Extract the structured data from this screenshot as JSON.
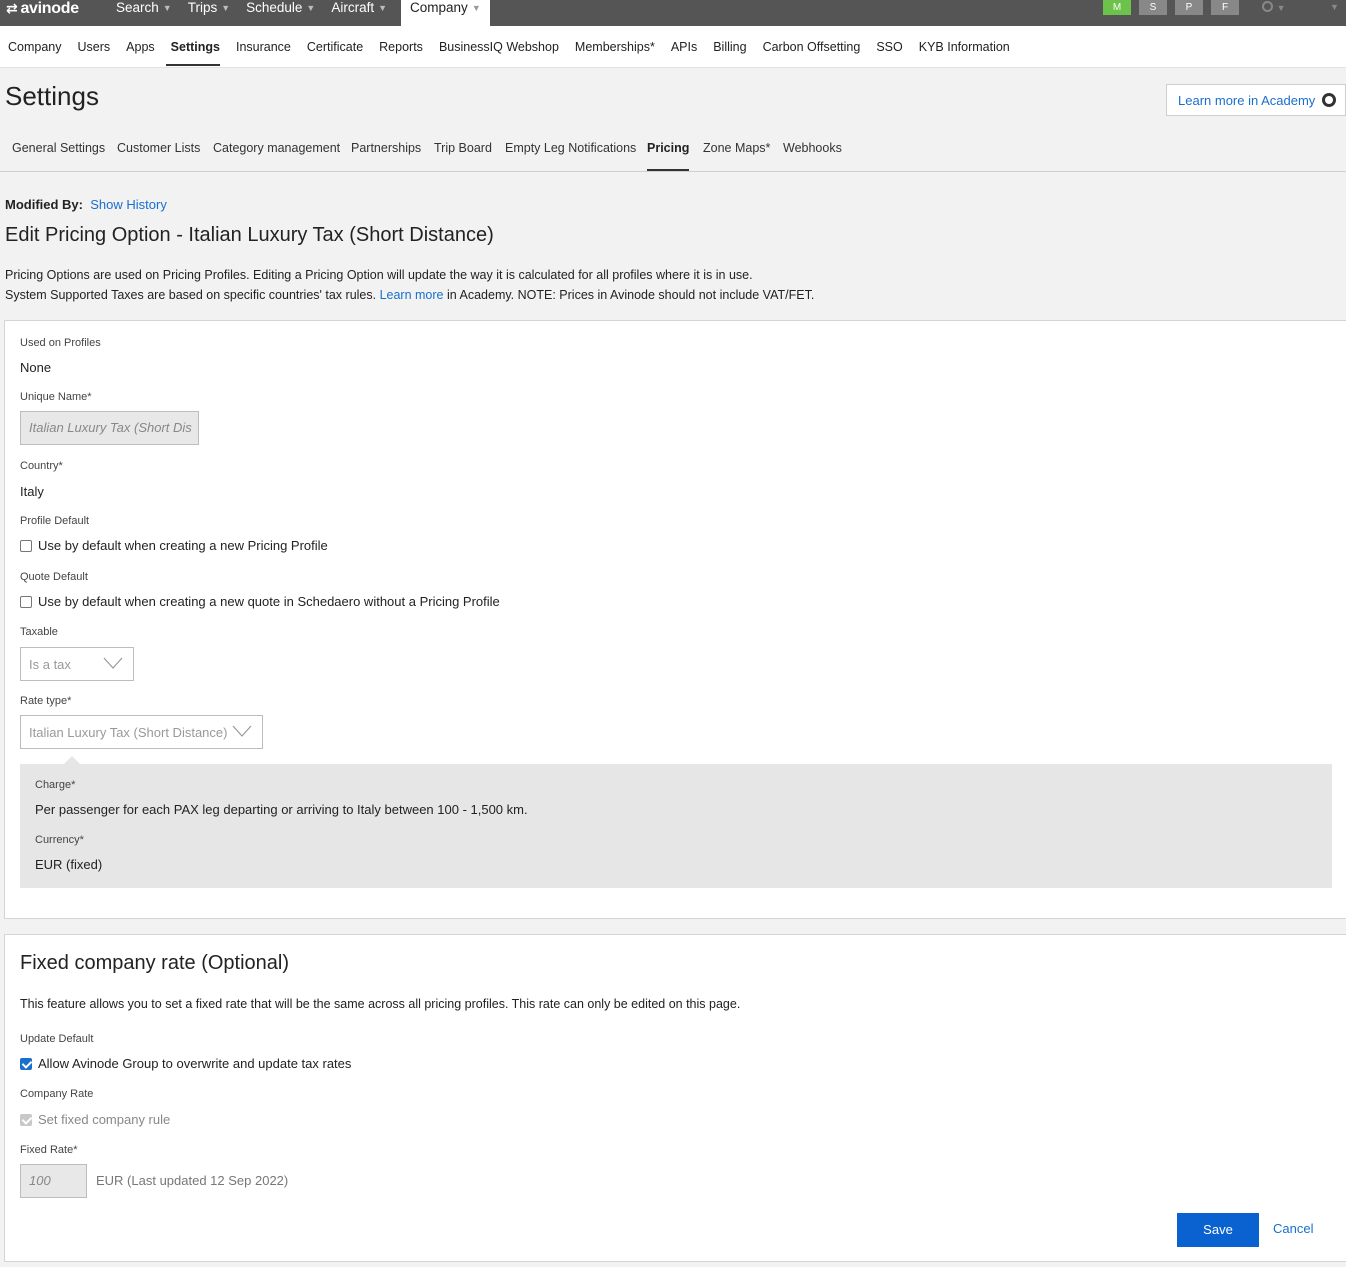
{
  "topbar": {
    "logo": "avinode",
    "nav": [
      {
        "label": "Search"
      },
      {
        "label": "Trips"
      },
      {
        "label": "Schedule"
      },
      {
        "label": "Aircraft"
      },
      {
        "label": "Company"
      }
    ],
    "badges": [
      "M",
      "S",
      "P",
      "F"
    ],
    "colors": {
      "bar": "#555555",
      "badge_active": "#6cc24a",
      "badge": "#888888"
    }
  },
  "subnav": {
    "links": [
      "Company",
      "Users",
      "Apps",
      "Settings",
      "Insurance",
      "Certificate",
      "Reports",
      "BusinessIQ Webshop",
      "Memberships*",
      "APIs",
      "Billing",
      "Carbon Offsetting",
      "SSO",
      "KYB Information"
    ],
    "active": "Settings"
  },
  "page": {
    "title": "Settings",
    "academy_button": "Learn more in Academy"
  },
  "tabs": {
    "items": [
      "General Settings",
      "Customer Lists",
      "Category management",
      "Partnerships",
      "Trip Board",
      "Empty Leg Notifications",
      "Pricing",
      "Zone Maps*",
      "Webhooks"
    ],
    "active": "Pricing"
  },
  "modified": {
    "label": "Modified By:",
    "link": "Show History"
  },
  "edit_title": "Edit Pricing Option - Italian Luxury Tax (Short Distance)",
  "intro": {
    "line1": "Pricing Options are used on Pricing Profiles. Editing a Pricing Option will update the way it is calculated for all profiles where it is in use.",
    "line2_a": "System Supported Taxes are based on specific countries' tax rules. ",
    "line2_link": "Learn more",
    "line2_b": " in Academy. NOTE: Prices in Avinode should not include VAT/FET."
  },
  "form": {
    "used_on_profiles_label": "Used on Profiles",
    "used_on_profiles_value": "None",
    "unique_name_label": "Unique Name*",
    "unique_name_value": "Italian Luxury Tax (Short Dis",
    "country_label": "Country*",
    "country_value": "Italy",
    "profile_default_label": "Profile Default",
    "profile_default_checkbox": "Use by default when creating a new Pricing Profile",
    "quote_default_label": "Quote Default",
    "quote_default_checkbox": "Use by default when creating a new quote in Schedaero without a Pricing Profile",
    "taxable_label": "Taxable",
    "taxable_value": "Is a tax",
    "rate_type_label": "Rate type*",
    "rate_type_value": "Italian Luxury Tax (Short Distance)",
    "charge_label": "Charge*",
    "charge_value": "Per passenger for each PAX leg departing or arriving to Italy between 100 - 1,500 km.",
    "currency_label": "Currency*",
    "currency_value": "EUR (fixed)"
  },
  "fixed": {
    "title": "Fixed company rate (Optional)",
    "description": "This feature allows you to set a fixed rate that will be the same across all pricing profiles. This rate can only be edited on this page.",
    "update_default_label": "Update Default",
    "update_default_checkbox": "Allow Avinode Group to overwrite and update tax rates",
    "update_default_checked": true,
    "company_rate_label": "Company Rate",
    "company_rate_checkbox": "Set fixed company rule",
    "company_rate_checked": true,
    "fixed_rate_label": "Fixed Rate*",
    "fixed_rate_value": "100",
    "fixed_rate_suffix": "EUR (Last updated 12 Sep 2022)",
    "save_label": "Save",
    "cancel_label": "Cancel",
    "save_color": "#0a62d0"
  }
}
